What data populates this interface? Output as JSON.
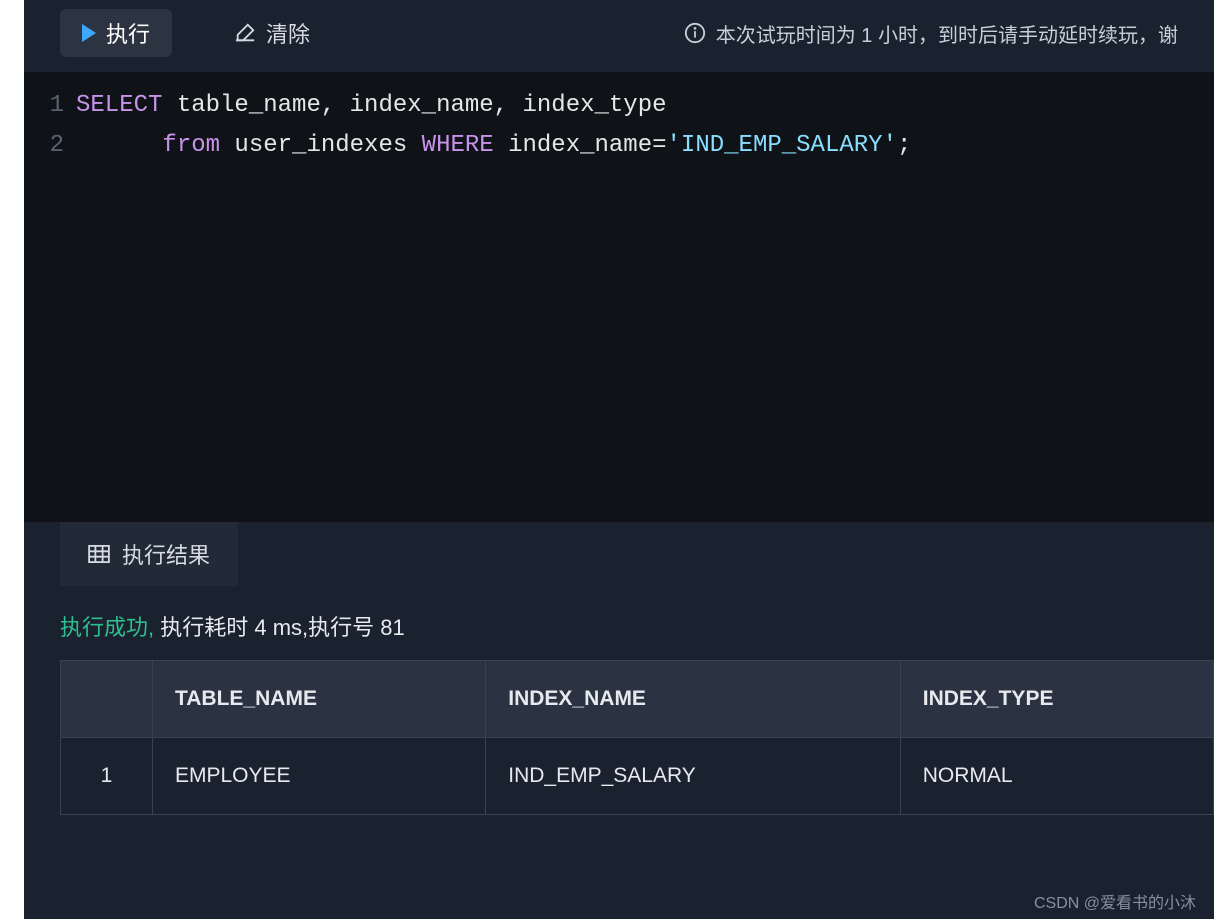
{
  "toolbar": {
    "run_label": "执行",
    "clear_label": "清除",
    "notice_text": "本次试玩时间为 1 小时，到时后请手动延时续玩，谢"
  },
  "editor": {
    "lines": [
      {
        "num": "1",
        "tokens": [
          {
            "t": "SELECT",
            "c": "kw"
          },
          {
            "t": " table_name, index_name, index_type",
            "c": "id"
          }
        ]
      },
      {
        "num": "2",
        "tokens": [
          {
            "t": "      ",
            "c": "id"
          },
          {
            "t": "from",
            "c": "kw"
          },
          {
            "t": " user_indexes ",
            "c": "id"
          },
          {
            "t": "WHERE",
            "c": "kw"
          },
          {
            "t": " index_name",
            "c": "id"
          },
          {
            "t": "=",
            "c": "pun"
          },
          {
            "t": "'IND_EMP_SALARY'",
            "c": "str"
          },
          {
            "t": ";",
            "c": "pun"
          }
        ]
      }
    ]
  },
  "tabs": {
    "results_label": "执行结果"
  },
  "status": {
    "success_text": "执行成功,",
    "detail_text": " 执行耗时 4 ms,执行号 81"
  },
  "result": {
    "columns": [
      "TABLE_NAME",
      "INDEX_NAME",
      "INDEX_TYPE"
    ],
    "rows": [
      {
        "n": "1",
        "cells": [
          "EMPLOYEE",
          "IND_EMP_SALARY",
          "NORMAL"
        ]
      }
    ]
  },
  "watermark": "CSDN @爱看书的小沐"
}
